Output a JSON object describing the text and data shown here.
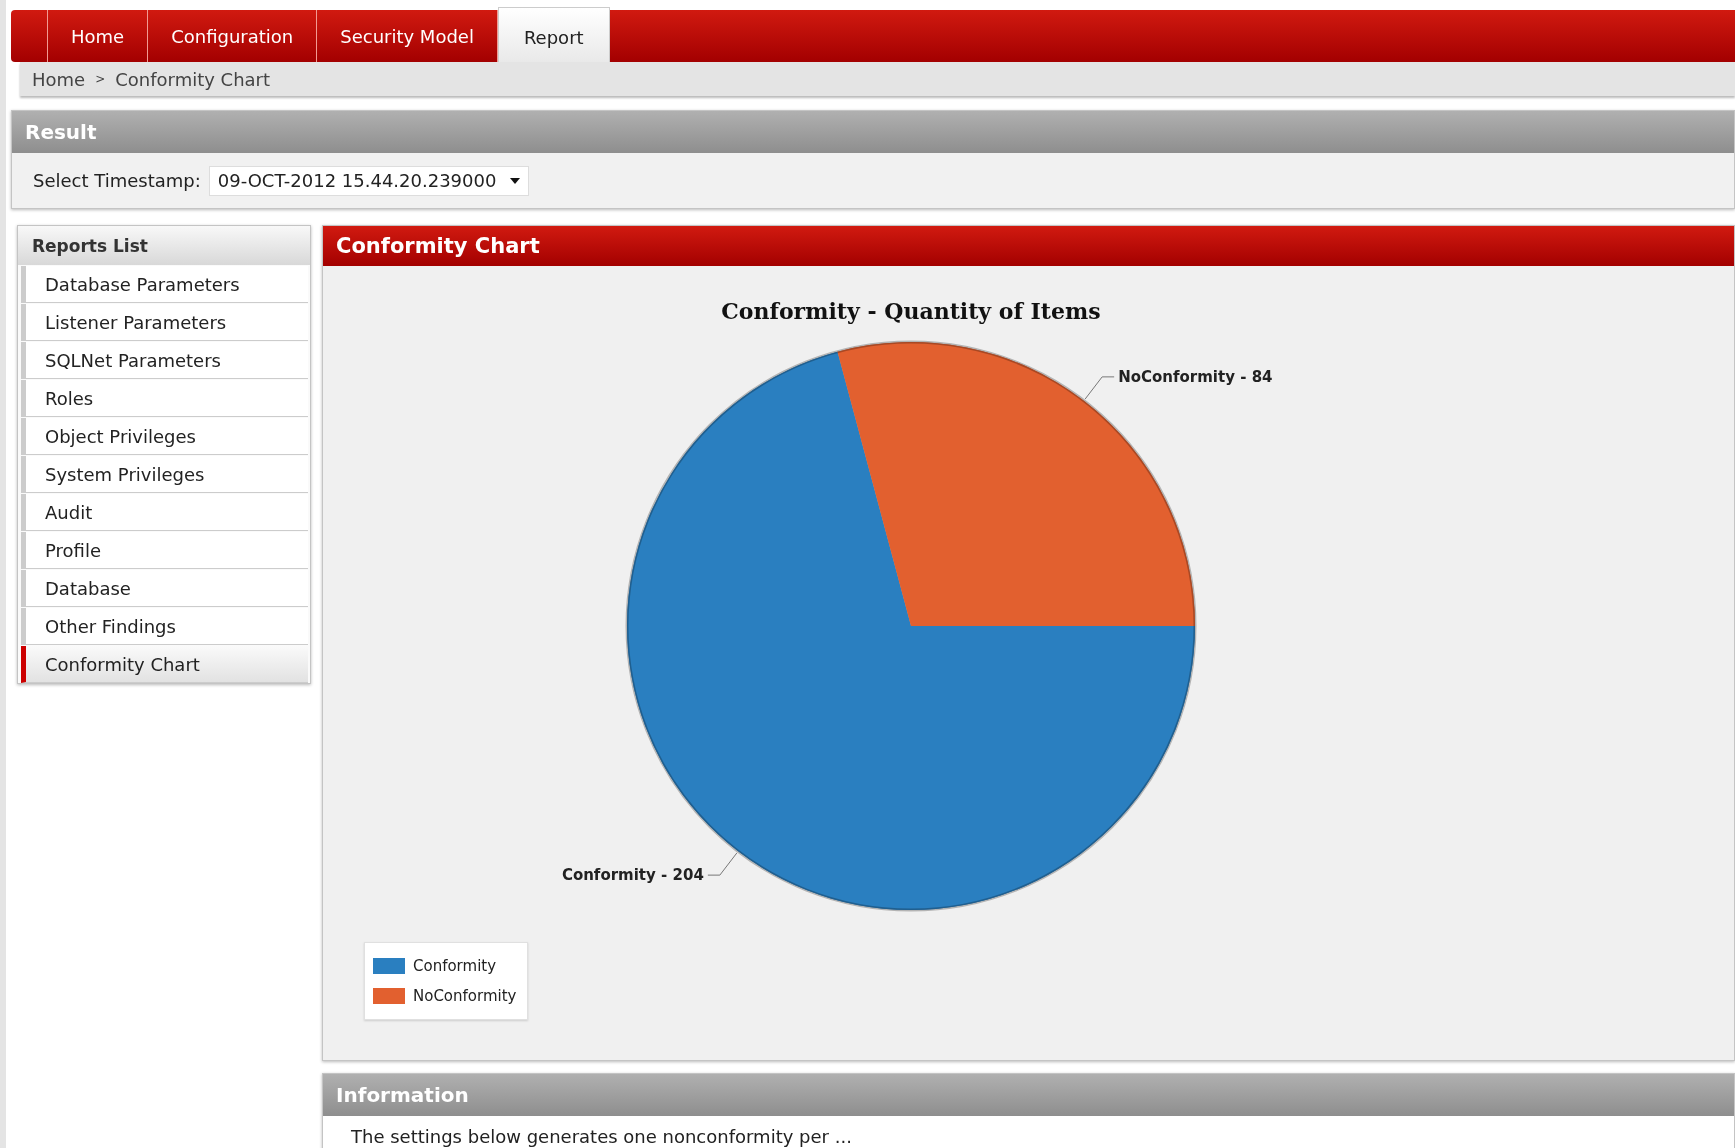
{
  "nav_tabs": [
    {
      "label": "Home",
      "selected": false
    },
    {
      "label": "Configuration",
      "selected": false
    },
    {
      "label": "Security Model",
      "selected": false
    },
    {
      "label": "Report",
      "selected": true
    }
  ],
  "breadcrumb": {
    "items": [
      "Home",
      "Conformity Chart"
    ],
    "separator": ">"
  },
  "result_panel": {
    "title": "Result",
    "timestamp_label": "Select Timestamp:",
    "timestamp_value": "09-OCT-2012 15.44.20.239000"
  },
  "reports_list": {
    "title": "Reports List",
    "items": [
      {
        "label": "Database Parameters",
        "selected": false
      },
      {
        "label": "Listener Parameters",
        "selected": false
      },
      {
        "label": "SQLNet Parameters",
        "selected": false
      },
      {
        "label": "Roles",
        "selected": false
      },
      {
        "label": "Object Privileges",
        "selected": false
      },
      {
        "label": "System Privileges",
        "selected": false
      },
      {
        "label": "Audit",
        "selected": false
      },
      {
        "label": "Profile",
        "selected": false
      },
      {
        "label": "Database",
        "selected": false
      },
      {
        "label": "Other Findings",
        "selected": false
      },
      {
        "label": "Conformity Chart",
        "selected": true
      }
    ]
  },
  "chart_panel": {
    "title": "Conformity Chart",
    "chart_data": {
      "type": "pie",
      "title": "Conformity - Quantity of Items",
      "categories": [
        "Conformity",
        "NoConformity"
      ],
      "values": [
        204,
        84
      ],
      "colors": [
        "#2a7fc0",
        "#e2602f"
      ],
      "data_labels": true
    },
    "data_label_separator": "-"
  },
  "information_panel": {
    "title": "Information",
    "text": "The settings below generates one nonconformity per ..."
  }
}
